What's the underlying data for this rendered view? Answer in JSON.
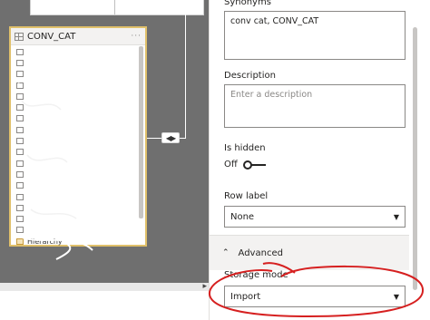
{
  "table": {
    "name": "CONV_CAT",
    "more": "···",
    "fields": [
      {
        "label": "",
        "icon": "column-icon"
      },
      {
        "label": "",
        "icon": "column-icon"
      },
      {
        "label": "",
        "icon": "column-icon"
      },
      {
        "label": "",
        "icon": "column-icon"
      },
      {
        "label": "",
        "icon": "column-icon"
      },
      {
        "label": "",
        "icon": "column-icon"
      },
      {
        "label": "",
        "icon": "column-icon"
      },
      {
        "label": "",
        "icon": "column-icon"
      },
      {
        "label": "",
        "icon": "column-icon"
      },
      {
        "label": "",
        "icon": "column-icon"
      },
      {
        "label": "",
        "icon": "column-icon"
      },
      {
        "label": "",
        "icon": "column-icon"
      },
      {
        "label": "",
        "icon": "column-icon"
      },
      {
        "label": "",
        "icon": "column-icon"
      },
      {
        "label": "",
        "icon": "column-icon"
      },
      {
        "label": "",
        "icon": "column-icon"
      },
      {
        "label": "",
        "icon": "column-icon"
      },
      {
        "label": "Hierarchy",
        "icon": "hierarchy-icon"
      }
    ]
  },
  "relationship": {
    "connector": "◀▶"
  },
  "properties": {
    "synonyms": {
      "label": "Synonyms",
      "value": "conv cat, CONV_CAT"
    },
    "description": {
      "label": "Description",
      "placeholder": "Enter a description"
    },
    "is_hidden": {
      "label": "Is hidden",
      "state": "Off"
    },
    "row_label": {
      "label": "Row label",
      "value": "None"
    },
    "advanced": {
      "label": "Advanced"
    },
    "storage_mode": {
      "label": "Storage mode",
      "value": "Import"
    }
  },
  "colors": {
    "canvas": "#6f6f6f",
    "selected_table_border": "#e0c06a",
    "annotation": "#d62020"
  },
  "icons": [
    "grid-icon",
    "chevron-up-icon",
    "caret-down-icon",
    "toggle-off-icon",
    "scroll-right-arrow-icon"
  ]
}
